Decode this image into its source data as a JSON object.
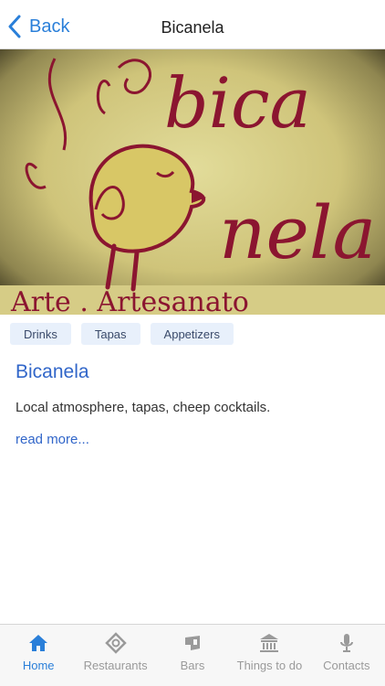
{
  "navbar": {
    "back_label": "Back",
    "title": "Bicanela"
  },
  "hero": {
    "sign_text_top": "bica",
    "sign_text_bottom": "nela",
    "sign_text_footer": "Arte . Artesanato"
  },
  "tags": [
    "Drinks",
    "Tapas",
    "Appetizers"
  ],
  "place": {
    "name": "Bicanela",
    "description": "Local atmosphere, tapas, cheep cocktails.",
    "read_more": "read more..."
  },
  "tabbar": {
    "active": "Home",
    "items": [
      {
        "label": "Home",
        "icon": "home-icon"
      },
      {
        "label": "Restaurants",
        "icon": "restaurants-icon"
      },
      {
        "label": "Bars",
        "icon": "bars-icon"
      },
      {
        "label": "Things to do",
        "icon": "museum-icon"
      },
      {
        "label": "Contacts",
        "icon": "microphone-icon"
      }
    ]
  },
  "colors": {
    "accent": "#2a7fd9",
    "title_blue": "#3166c9",
    "tag_bg": "#e8f0fb",
    "sign_red": "#8b1530",
    "sign_bg": "#d9d28a"
  }
}
